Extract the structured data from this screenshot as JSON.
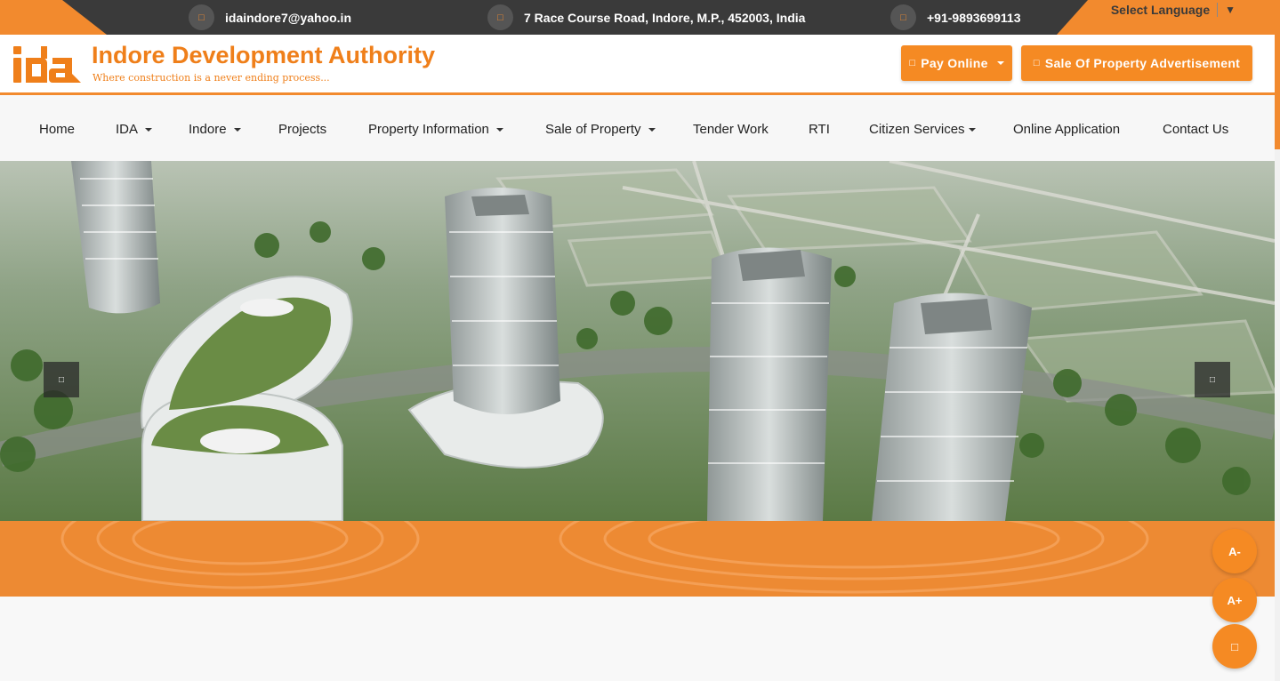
{
  "topbar": {
    "email": "idaindore7@yahoo.in",
    "address": "7 Race Course Road, Indore, M.P., 452003, India",
    "phone": "+91-9893699113",
    "language_label": "Select Language"
  },
  "header": {
    "logo_text": "ida",
    "title": "Indore Development Authority",
    "tagline": "Where construction is a never ending process...",
    "pay_online": "Pay Online",
    "sale_advert": "Sale Of Property Advertisement"
  },
  "nav": {
    "items": [
      {
        "label": "Home",
        "dropdown": false
      },
      {
        "label": "IDA",
        "dropdown": true
      },
      {
        "label": "Indore",
        "dropdown": true
      },
      {
        "label": "Projects",
        "dropdown": false
      },
      {
        "label": "Property Information",
        "dropdown": true
      },
      {
        "label": "Sale of Property",
        "dropdown": true
      },
      {
        "label": "Tender Work",
        "dropdown": false
      },
      {
        "label": "RTI",
        "dropdown": false
      },
      {
        "label": "Citizen Services",
        "dropdown": true
      },
      {
        "label": "Online Application",
        "dropdown": false
      },
      {
        "label": "Contact Us",
        "dropdown": false
      }
    ]
  },
  "slider": {
    "prev_icon": "chevron-left-icon",
    "next_icon": "chevron-right-icon"
  },
  "accessibility": {
    "decrease_font": "A-",
    "increase_font": "A+",
    "third_icon": "accessibility-icon"
  },
  "colors": {
    "accent": "#f28a2e",
    "topbar_bg": "#3a3a3a",
    "brand_text": "#ef7f1a"
  }
}
